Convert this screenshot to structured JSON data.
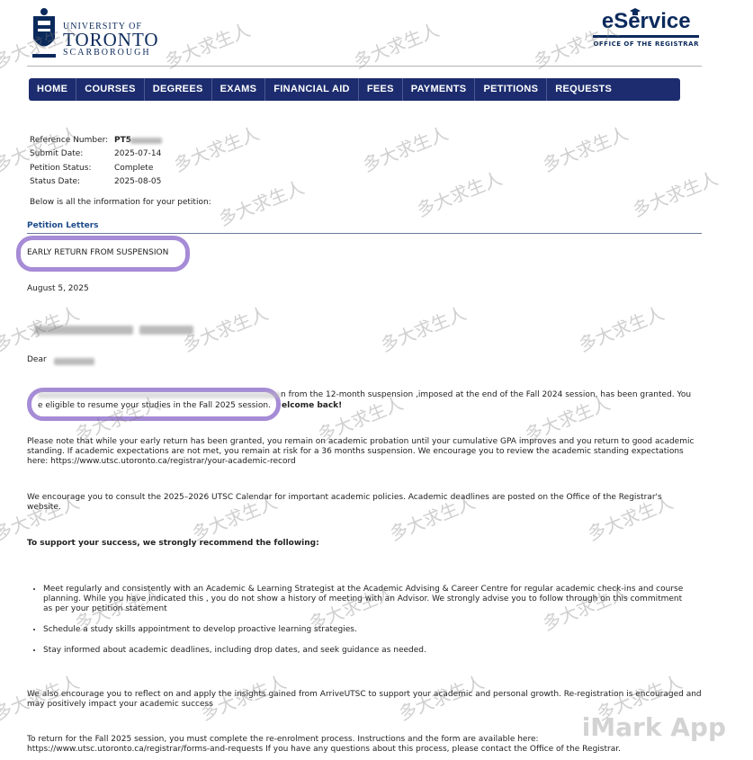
{
  "header": {
    "university_line1": "UNIVERSITY OF",
    "university_line2": "TORONTO",
    "university_line3": "SCARBOROUGH",
    "eservice_title": "eService",
    "eservice_subtitle": "OFFICE OF THE REGISTRAR"
  },
  "nav": {
    "items": [
      "HOME",
      "COURSES",
      "DEGREES",
      "EXAMS",
      "FINANCIAL AID",
      "FEES",
      "PAYMENTS",
      "PETITIONS",
      "REQUESTS"
    ]
  },
  "petition": {
    "reference_label": "Reference Number:",
    "reference_value": "PT5",
    "submit_label": "Submit Date:",
    "submit_value": "2025-07-14",
    "status_label": "Petition Status:",
    "status_value": "Complete",
    "status_date_label": "Status Date:",
    "status_date_value": "2025-08-05",
    "intro": "Below is all the information for your petition:"
  },
  "letters": {
    "section_title": "Petition Letters",
    "letter_title": "EARLY RETURN FROM SUSPENSION",
    "date": "August 5, 2025",
    "dear": "Dear",
    "p1_a": "n from the 12-month suspension ,imposed at the end of the Fall 2024 session, has been granted. You",
    "p1_b": "e eligible to resume your studies in the Fall 2025 session.",
    "p1_c": "elcome back!",
    "p2": "Please note that while your early return has been granted, you remain on academic probation until your cumulative GPA improves and you return to good academic standing.  If academic expectations are not met, you remain at risk for a 36  months suspension. We encourage you to review the academic standing expectations here: https://www.utsc.utoronto.ca/registrar/your-academic-record",
    "p3": "We encourage you to  consult the 2025–2026 UTSC Calendar for important academic policies. Academic deadlines are posted on the Office of the Registrar's website.",
    "support_heading": "To support your success, we strongly recommend the following:",
    "bullets": [
      "Meet regularly and consistently with an Academic & Learning Strategist at the Academic Advising & Career Centre for regular academic check-ins and course planning. While you have indicated this , you do not show a history of meeting with an Advisor. We strongly advise you to follow through on this commitment as per your petition statement",
      "Schedule a study skills appointment to develop proactive learning strategies.",
      "Stay informed about academic deadlines, including drop dates, and seek guidance as needed."
    ],
    "p4": "We also encourage you to reflect on and apply the insights gained from ArriveUTSC to support your academic and personal growth. Re-registration is encouraged and may positively impact your academic success",
    "p5": "To return for the Fall 2025 session, you must complete the re-enrolment process. Instructions and the form are available here: https://www.utsc.utoronto.ca/registrar/forms-and-requests If you have any questions about this process, please contact the Office of the Registrar."
  },
  "watermark_text": "多大求生人",
  "brand_watermark": "iMark App"
}
